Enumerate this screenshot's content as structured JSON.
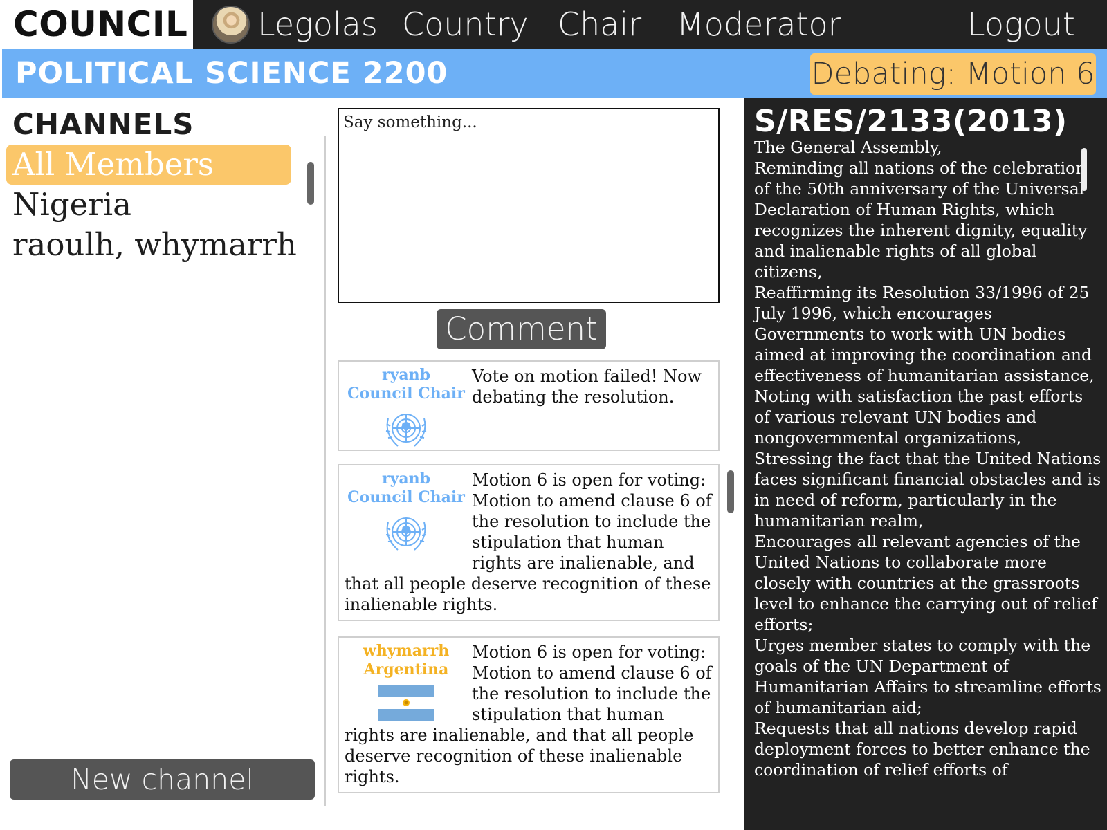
{
  "nav": {
    "brand": "COUNCIL",
    "user": "Legolas",
    "items": [
      "Country",
      "Chair",
      "Moderator"
    ],
    "logout": "Logout"
  },
  "course": {
    "title": "POLITICAL SCIENCE 2200",
    "status": "Debating: Motion 6"
  },
  "channels": {
    "heading": "CHANNELS",
    "items": [
      "All Members",
      "Nigeria",
      "raoulh, whymarrh"
    ],
    "new_button": "New channel"
  },
  "composer": {
    "placeholder": "Say something...",
    "button": "Comment"
  },
  "posts": [
    {
      "user": "ryanb",
      "role": "Council Chair",
      "icon": "un-emblem-icon",
      "text": "Vote on motion failed! Now debating the resolution."
    },
    {
      "user": "ryanb",
      "role": "Council Chair",
      "icon": "un-emblem-icon",
      "text": "Motion 6 is open for voting: Motion to amend clause 6 of the resolution to include the stipulation that human rights are inalienable, and that all people deserve recognition of these inalienable rights."
    },
    {
      "user": "whymarrh",
      "role": "Argentina",
      "icon": "argentina-flag-icon",
      "text": "Motion 6 is open for voting: Motion to amend clause 6 of the resolution to include the stipulation that human rights are inalienable, and that all people deserve recognition of these inalienable rights."
    }
  ],
  "resolution": {
    "title": "S/RES/2133(2013)",
    "paragraphs": [
      "The General Assembly,",
      "Reminding all nations of the celebration of the 50th anniversary of the Universal Declaration of Human Rights, which recognizes the inherent dignity, equality and inalienable rights of all global citizens,",
      "Reaffirming its Resolution 33/1996 of 25 July 1996, which encourages Governments to work with UN bodies aimed at improving the coordination and effectiveness of humanitarian assistance,",
      "Noting with satisfaction the past efforts of various relevant UN bodies and nongovernmental organizations,",
      "Stressing the fact that the United Nations faces significant financial obstacles and is in need of reform, particularly in the humanitarian realm,",
      "Encourages all relevant agencies of the United Nations to collaborate more closely with countries at the grassroots level to enhance the carrying out of relief efforts;",
      "Urges member states to comply with the goals of the UN Department of Humanitarian Affairs to streamline efforts of humanitarian aid;",
      "Requests that all nations develop rapid deployment forces to better enhance the coordination of relief efforts of"
    ]
  },
  "colors": {
    "nav_bg": "#222222",
    "course_bar": "#6db0f6",
    "accent_gold": "#fbc76a",
    "chair_blue": "#6db0f6",
    "country_gold": "#f4b223",
    "button_gray": "#555555"
  }
}
